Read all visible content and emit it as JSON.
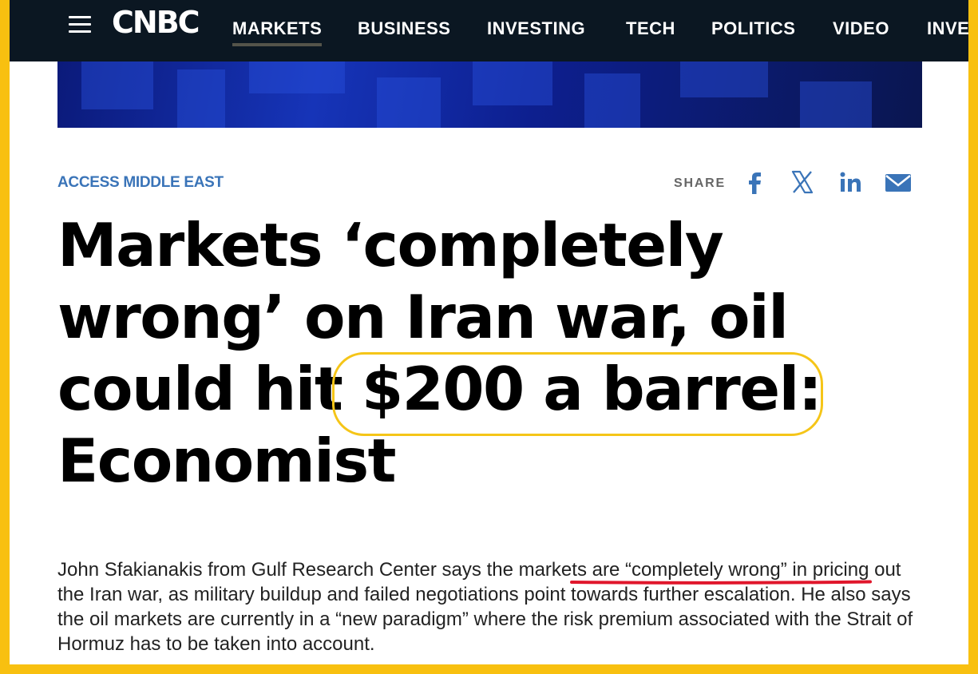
{
  "nav": {
    "logo": "CNBC",
    "items": [
      "MARKETS",
      "BUSINESS",
      "INVESTING",
      "TECH",
      "POLITICS",
      "VIDEO",
      "INVE"
    ],
    "active": "MARKETS"
  },
  "article": {
    "section": "ACCESS MIDDLE EAST",
    "share_label": "SHARE",
    "share_icons": [
      "facebook-icon",
      "x-icon",
      "linkedin-icon",
      "email-icon"
    ],
    "headline_lines": [
      "Markets ‘completely",
      "wrong’ on Iran war, oil",
      "could hit ",
      "$200 a barrel:",
      "Economist"
    ],
    "lede": {
      "before": "John Sfakianakis from Gulf Research Center says the ",
      "underlined": "markets are “completely wrong",
      "after": "” in pricing out the Iran war, as military buildup and failed negotiations point towards further escalation. He also says the oil markets are currently in a “new paradigm” where the risk premium associated with the Strait of Hormuz has to be taken into account."
    }
  },
  "colors": {
    "frame": "#f8c010",
    "nav_bg": "#0b1722",
    "section": "#3a74b8",
    "share_icons": "#3a74b8",
    "annotation_oval": "#f5c518",
    "annotation_underline": "#e0162b"
  }
}
